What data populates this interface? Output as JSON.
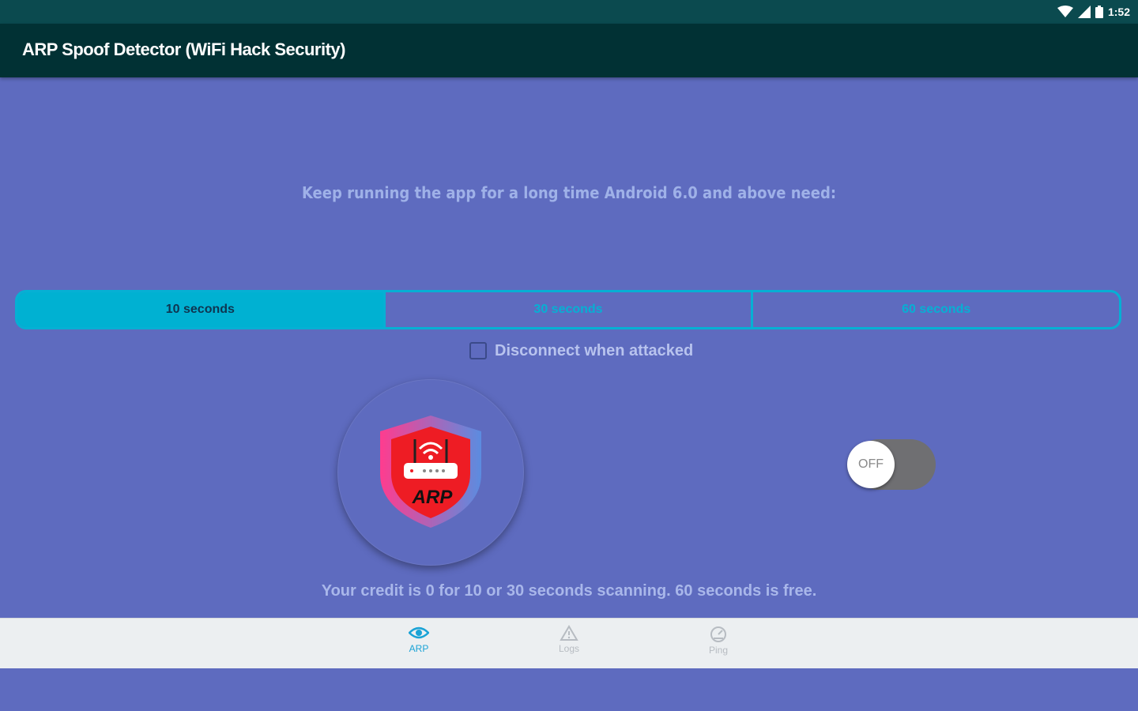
{
  "status_bar": {
    "time": "1:52",
    "icons": [
      "wifi-icon",
      "signal-icon",
      "battery-icon"
    ]
  },
  "app_bar": {
    "title": "ARP Spoof Detector (WiFi Hack Security)"
  },
  "main": {
    "hint": "Keep running the app for a long time Android 6.0 and above need:",
    "intervals": [
      {
        "label": "10 seconds",
        "selected": true
      },
      {
        "label": "30 seconds",
        "selected": false
      },
      {
        "label": "60 seconds",
        "selected": false
      }
    ],
    "disconnect_checkbox": {
      "label": "Disconnect when attacked",
      "checked": false
    },
    "logo": {
      "icon": "arp-shield-router-icon",
      "text": "ARP"
    },
    "scan_switch": {
      "label": "OFF",
      "on": false
    },
    "credit_text": "Your credit is 0 for 10 or 30 seconds scanning. 60 seconds is free."
  },
  "bottom_nav": {
    "items": [
      {
        "label": "ARP",
        "icon": "eye-icon",
        "active": true
      },
      {
        "label": "Logs",
        "icon": "warning-icon",
        "active": false
      },
      {
        "label": "Ping",
        "icon": "speedometer-icon",
        "active": false
      }
    ]
  },
  "colors": {
    "background": "#5e6bbf",
    "app_bar": "#013134",
    "status_bar": "#0b4a4f",
    "accent": "#00b1d2",
    "nav_active": "#1aa3d6",
    "switch_track": "#6f6f72"
  }
}
